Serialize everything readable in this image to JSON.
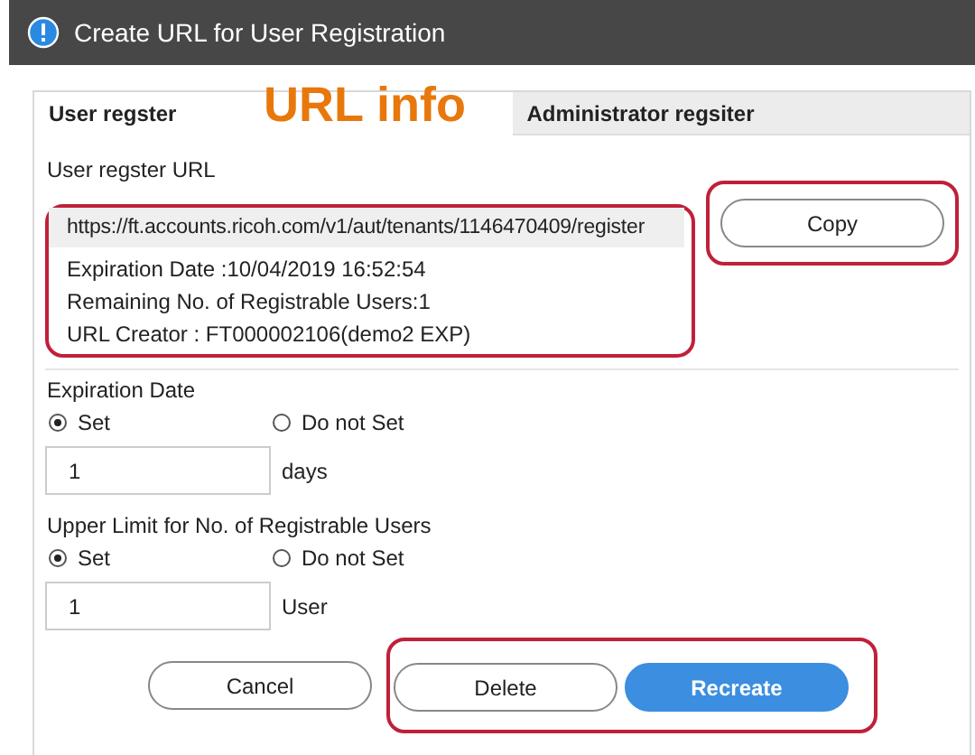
{
  "window": {
    "title": "Create URL for User Registration"
  },
  "annotation": {
    "label": "URL info"
  },
  "tabs": [
    {
      "label": "User regster",
      "selected": true
    },
    {
      "label": "Administrator regsiter",
      "selected": false
    }
  ],
  "url_section": {
    "label": "User regster URL",
    "url": "https://ft.accounts.ricoh.com/v1/aut/tenants/1146470409/register",
    "info_lines": [
      "Expiration Date :10/04/2019 16:52:54",
      "Remaining No. of Registrable Users:1",
      "URL Creator : FT000002106(demo2 EXP)"
    ],
    "copy_button": "Copy"
  },
  "settings": [
    {
      "label": "Expiration Date",
      "options": [
        {
          "label": "Set",
          "selected": true
        },
        {
          "label": "Do not Set",
          "selected": false
        }
      ],
      "value": "1",
      "unit": "days"
    },
    {
      "label": "Upper Limit for No. of Registrable Users",
      "options": [
        {
          "label": "Set",
          "selected": true
        },
        {
          "label": "Do not Set",
          "selected": false
        }
      ],
      "value": "1",
      "unit": "User"
    }
  ],
  "buttons": [
    {
      "label": "Cancel",
      "kind": "outline",
      "highlighted": false
    },
    {
      "label": "Delete",
      "kind": "outline",
      "highlighted": true
    },
    {
      "label": "Recreate",
      "kind": "primary",
      "highlighted": true
    }
  ]
}
